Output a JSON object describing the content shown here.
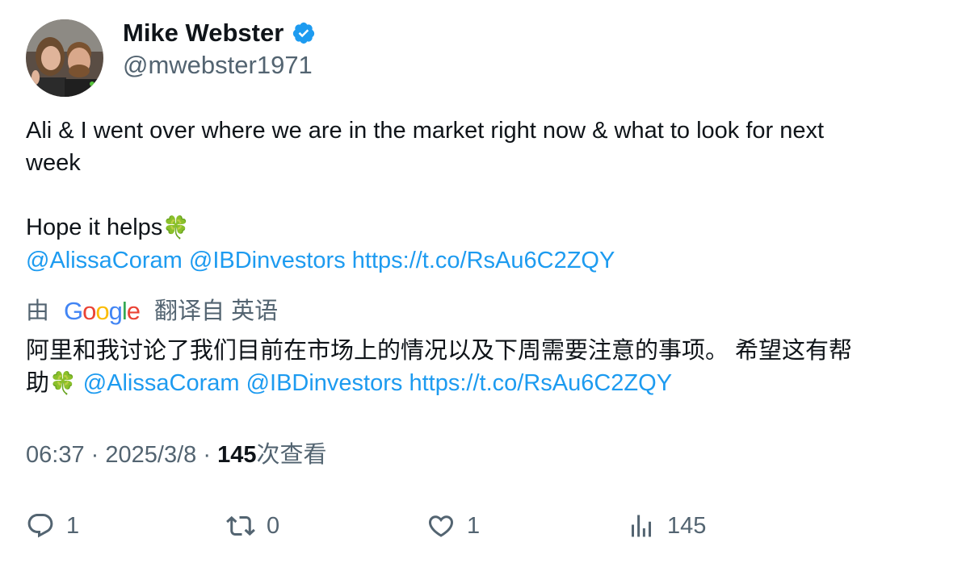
{
  "author": {
    "name": "Mike Webster",
    "handle": "@mwebster1971",
    "verified_color": "#1d9bf0"
  },
  "tweet": {
    "line1": "Ali & I went over where we are in the market right now & what to look for next",
    "line2": "week",
    "line3": "Hope it helps",
    "mentions": [
      "@AlissaCoram",
      "@IBDinvestors"
    ],
    "url": "https://t.co/RsAu6C2ZQY",
    "emoji": "🍀"
  },
  "translation": {
    "by": "由",
    "google": [
      "G",
      "o",
      "o",
      "g",
      "l",
      "e"
    ],
    "from_label": "翻译自 英语",
    "text_line1": "阿里和我讨论了我们目前在市场上的情况以及下周需要注意的事项。 希望这有帮",
    "text_line2_prefix": "助",
    "emoji": "🍀",
    "mentions": [
      "@AlissaCoram",
      "@IBDinvestors"
    ],
    "url": "https://t.co/RsAu6C2ZQY"
  },
  "meta": {
    "time": "06:37",
    "sep": "·",
    "date": "2025/3/8",
    "views_count": "145",
    "views_label": "次查看"
  },
  "actions": {
    "reply_count": "1",
    "retweet_count": "0",
    "like_count": "1",
    "views_count": "145"
  },
  "colors": {
    "link": "#1d9bf0",
    "muted": "#536471",
    "text": "#0f1419"
  }
}
